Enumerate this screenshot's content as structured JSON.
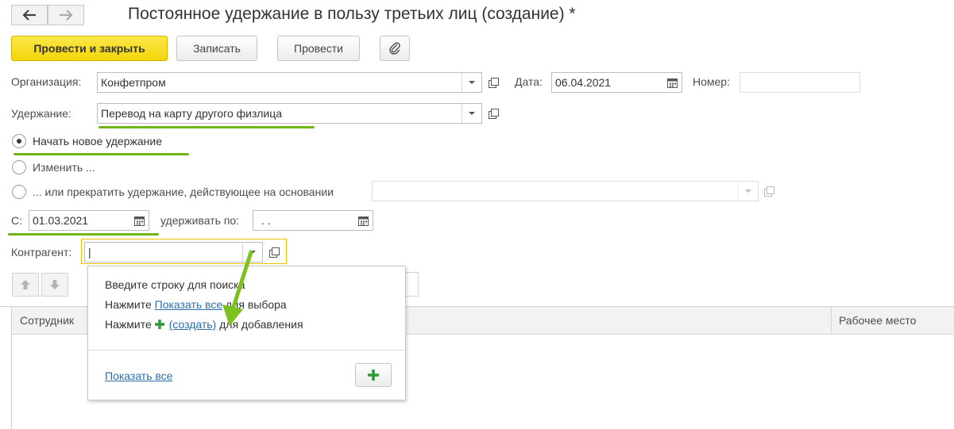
{
  "window": {
    "title": "Постоянное удержание в пользу третьих лиц (создание) *"
  },
  "nav": {
    "back_icon": "arrow-left-icon",
    "forward_icon": "arrow-right-icon"
  },
  "toolbar": {
    "post_close_label": "Провести и закрыть",
    "save_label": "Записать",
    "post_label": "Провести",
    "attach_icon": "paperclip-icon"
  },
  "form": {
    "org_label": "Организация:",
    "org_value": "Конфетпром",
    "date_label": "Дата:",
    "date_value": "06.04.2021",
    "number_label": "Номер:",
    "number_value": "",
    "deduction_label": "Удержание:",
    "deduction_value": "Перевод на карту другого физлица",
    "radio_new": "Начать новое удержание",
    "radio_change": "Изменить ...",
    "radio_stop": "... или прекратить удержание, действующее на основании",
    "stop_basis_value": "",
    "from_label": "С:",
    "from_value": "01.03.2021",
    "until_label": "удерживать по:",
    "until_value": " .  .",
    "counterparty_label": "Контрагент:",
    "counterparty_value": "|"
  },
  "table": {
    "col_employee": "Сотрудник",
    "col_workplace": "Рабочее место"
  },
  "popup": {
    "line1": "Введите строку для поиска",
    "line2_prefix": "Нажмите ",
    "line2_link": "Показать все",
    "line2_suffix": " для выбора",
    "line3_prefix": "Нажмите ",
    "line3_link": "(создать)",
    "line3_suffix": " для добавления",
    "show_all": "Показать все"
  },
  "colors": {
    "accent_yellow": "#f4d509",
    "highlight_green": "#6fb516",
    "link_blue": "#2c6fa8",
    "focus_border": "#f0c000"
  }
}
